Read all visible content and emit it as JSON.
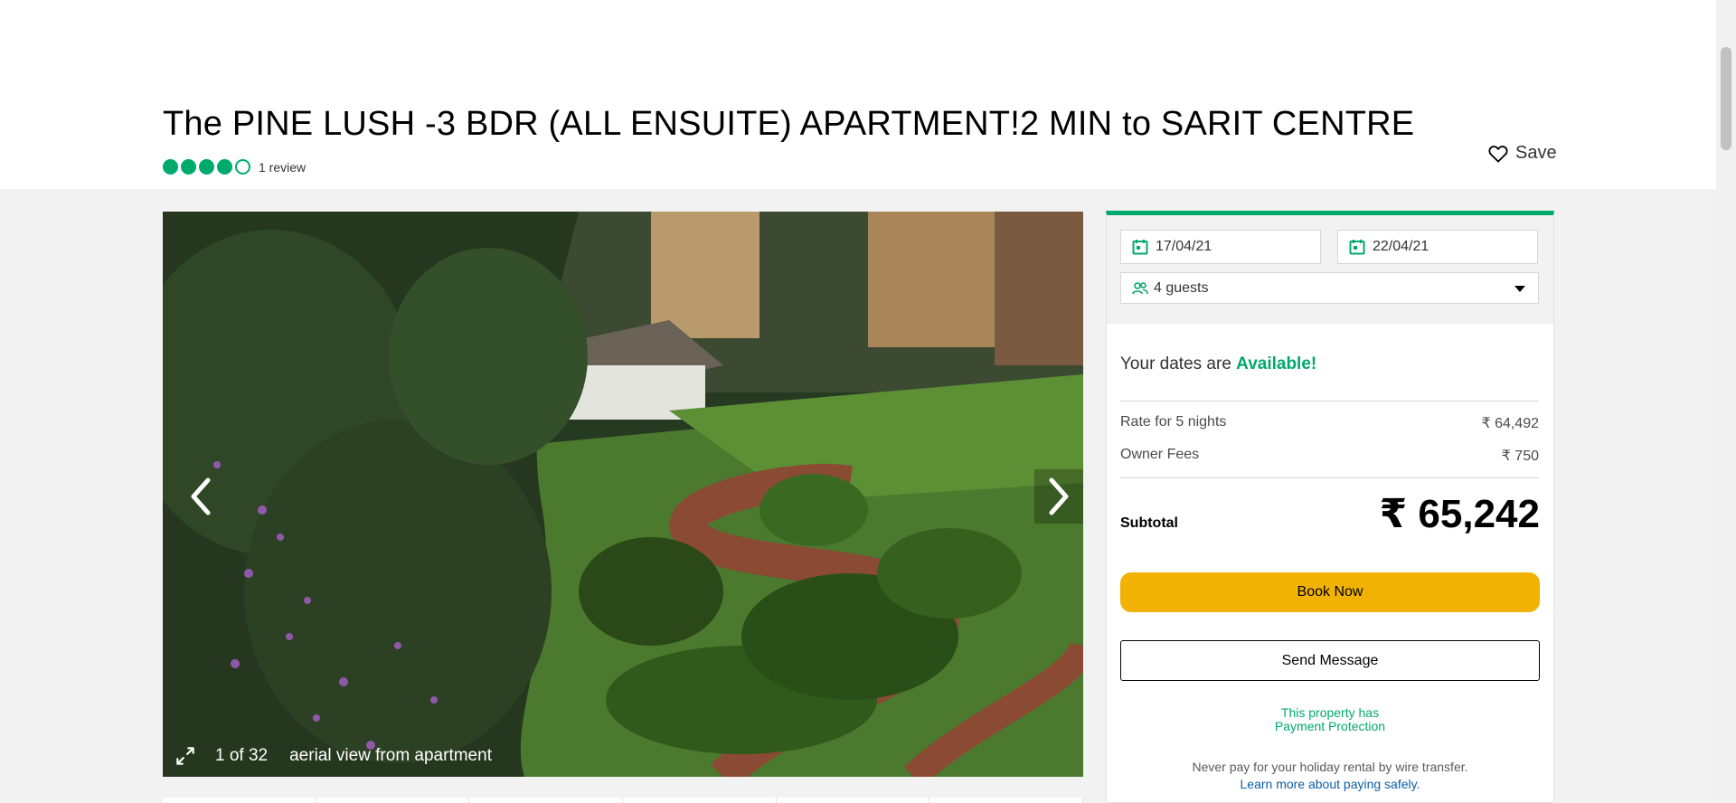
{
  "listing": {
    "title": "The PINE LUSH -3 BDR (ALL ENSUITE) APARTMENT!2 MIN to SARIT CENTRE",
    "rating": 4,
    "rating_max": 5,
    "review_count": "1 review",
    "save_label": "Save"
  },
  "gallery": {
    "counter": "1 of 32",
    "caption": "aerial view from apartment"
  },
  "booking": {
    "check_in": "17/04/21",
    "check_out": "22/04/21",
    "guests": "4 guests",
    "availability_prefix": "Your dates are",
    "availability_status": "Available!",
    "rate_label": "Rate for 5 nights",
    "rate_value": "₹ 64,492",
    "fees_label": "Owner Fees",
    "fees_value": "₹ 750",
    "subtotal_label": "Subtotal",
    "subtotal_value": "₹ 65,242",
    "book_label": "Book Now",
    "message_label": "Send Message",
    "protection_line1": "This property has",
    "protection_line2": "Payment Protection",
    "wire_warning": "Never pay for your holiday rental by wire transfer.",
    "learn_more": "Learn more about paying safely."
  },
  "colors": {
    "accent_green": "#00aa6c",
    "book_yellow": "#f2b203"
  }
}
